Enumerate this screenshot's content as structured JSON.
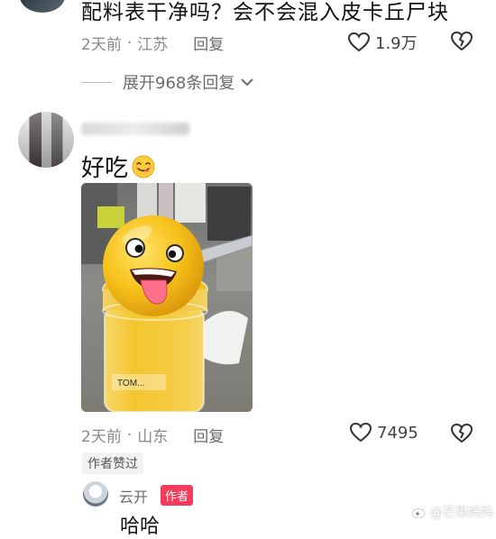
{
  "top_comment": {
    "text": "配料表干净吗？会不会混入皮卡丘尸块",
    "time": "2天前",
    "location": "江苏",
    "reply_label": "回复",
    "likes": "1.9万"
  },
  "expand_replies": "展开968条回复",
  "comment": {
    "text": "好吃",
    "time": "2天前",
    "location": "山东",
    "reply_label": "回复",
    "likes": "7495",
    "author_liked": "作者赞过"
  },
  "author_reply": {
    "name": "云开",
    "badge": "作者",
    "text": "哈哈"
  },
  "watermark": "@芒果妈妈",
  "colors": {
    "author_badge": "#f43b5a",
    "muted": "#8a8a8a"
  },
  "icons": [
    "heart-icon",
    "broken-heart-icon",
    "chevron-down-icon",
    "weibo-icon"
  ]
}
